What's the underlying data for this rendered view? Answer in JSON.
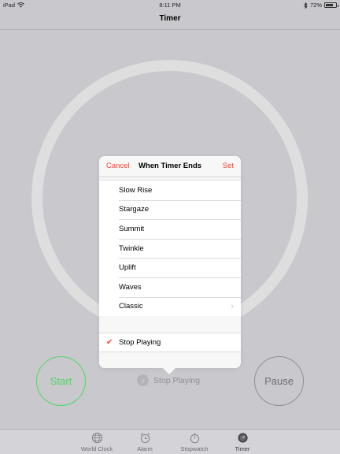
{
  "status_bar": {
    "device": "iPad",
    "time": "8:11 PM",
    "battery": "72%",
    "battery_level": 0.72
  },
  "nav": {
    "title": "Timer"
  },
  "popover": {
    "cancel_label": "Cancel",
    "title": "When Timer Ends",
    "set_label": "Set",
    "items": [
      {
        "label": "Slow Rise"
      },
      {
        "label": "Stargaze"
      },
      {
        "label": "Summit"
      },
      {
        "label": "Twinkle"
      },
      {
        "label": "Uplift"
      },
      {
        "label": "Waves"
      },
      {
        "label": "Classic"
      }
    ],
    "stop_playing_label": "Stop Playing"
  },
  "controls": {
    "start_label": "Start",
    "pause_label": "Pause",
    "sound_label": "Stop Playing"
  },
  "tabs": [
    {
      "label": "World Clock",
      "icon": "globe-icon"
    },
    {
      "label": "Alarm",
      "icon": "alarm-clock-icon"
    },
    {
      "label": "Stopwatch",
      "icon": "stopwatch-icon"
    },
    {
      "label": "Timer",
      "icon": "timer-icon"
    }
  ],
  "colors": {
    "accent": "#ff3b30",
    "start_green": "#4cd964",
    "background": "#c9c8cd"
  }
}
